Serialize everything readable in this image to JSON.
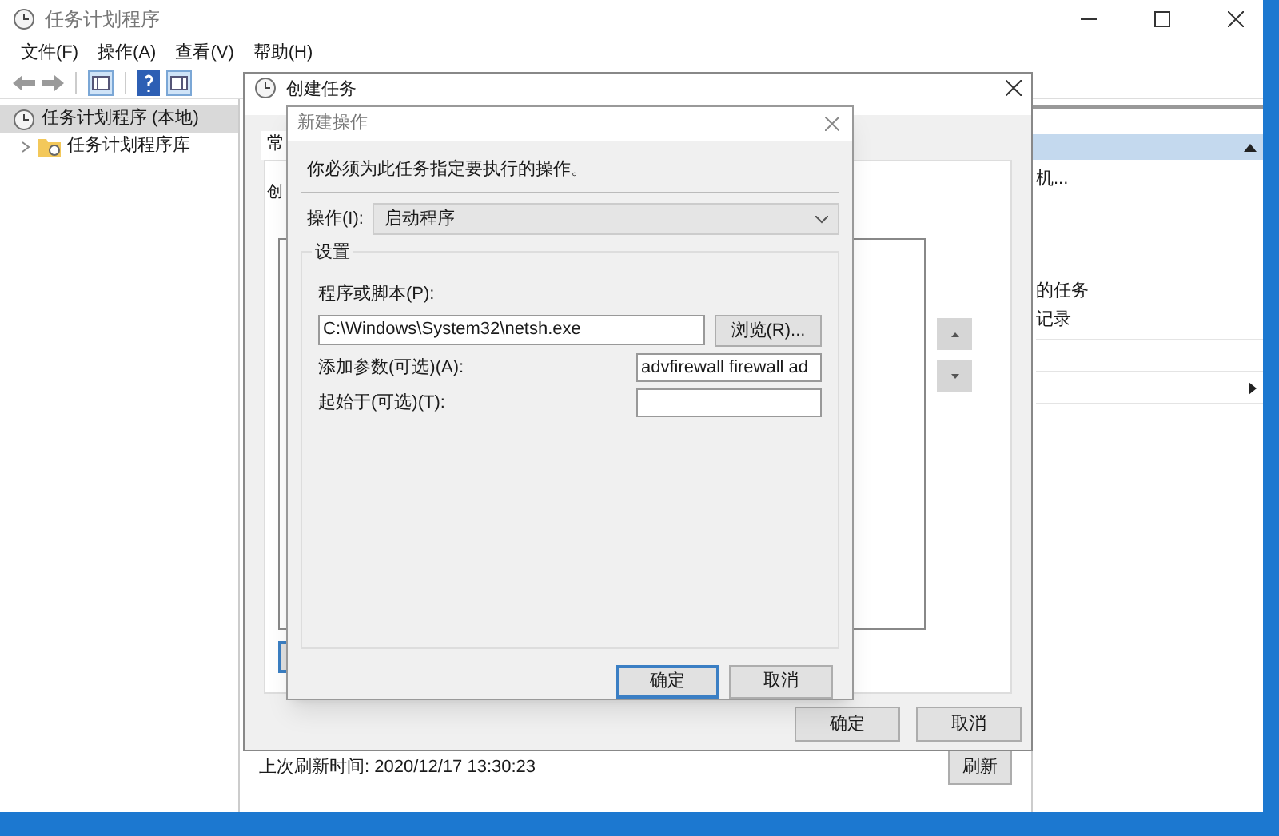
{
  "window": {
    "title": "任务计划程序"
  },
  "menu": [
    "文件(F)",
    "操作(A)",
    "查看(V)",
    "帮助(H)"
  ],
  "tree": [
    {
      "label": "任务计划程序 (本地)",
      "selected": true,
      "children": [
        {
          "label": "任务计划程序库",
          "selected": false,
          "expanded": false
        }
      ]
    }
  ],
  "background_dialog": {
    "title": "创建任务",
    "tab": "常",
    "line": "创",
    "buttons": [
      "确定",
      "取消"
    ]
  },
  "actions_pane": {
    "items": [
      "机...",
      "的任务",
      "记录"
    ]
  },
  "status": {
    "text": "上次刷新时间: 2020/12/17 13:30:23",
    "button": "刷新"
  },
  "dialog": {
    "title": "新建操作",
    "instruction": "你必须为此任务指定要执行的操作。",
    "action_label": "操作(I):",
    "action_value": "启动程序",
    "group": "设置",
    "fields": [
      {
        "label": "程序或脚本(P):",
        "value": "C:\\Windows\\System32\\netsh.exe",
        "button": "浏览(R)..."
      },
      {
        "label": "添加参数(可选)(A):",
        "value": "advfirewall firewall ad"
      },
      {
        "label": "起始于(可选)(T):"
      }
    ],
    "buttons": [
      {
        "label": "确定",
        "default": true
      },
      {
        "label": "取消",
        "default": false
      }
    ]
  }
}
